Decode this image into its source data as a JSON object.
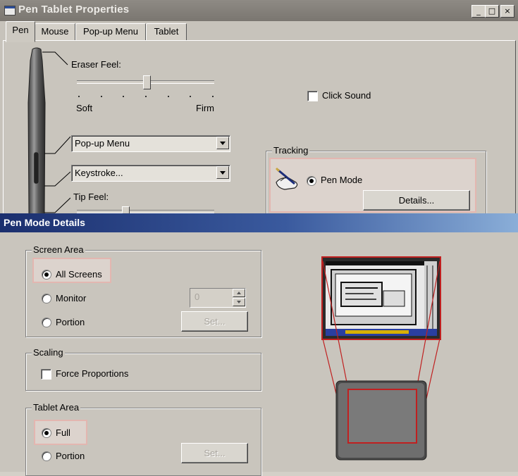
{
  "win1": {
    "title": "Pen Tablet Properties",
    "controls": {
      "minimize": "_",
      "maximize": "□",
      "close": "×"
    },
    "tabs": [
      {
        "label": "Pen",
        "active": true
      },
      {
        "label": "Mouse",
        "active": false
      },
      {
        "label": "Pop-up Menu",
        "active": false
      },
      {
        "label": "Tablet",
        "active": false
      }
    ],
    "eraser_feel": {
      "label": "Eraser Feel:",
      "min_label": "Soft",
      "max_label": "Firm",
      "ticks": 7,
      "value_fraction": 0.5
    },
    "side_switch_upper": "Pop-up Menu",
    "side_switch_lower": "Keystroke...",
    "tip_feel": {
      "label": "Tip Feel:"
    },
    "click_sound": {
      "label": "Click Sound",
      "checked": false
    },
    "tracking": {
      "title": "Tracking",
      "pen_mode_label": "Pen Mode",
      "details_button": "Details..."
    }
  },
  "win2": {
    "title": "Pen Mode Details",
    "screen_area": {
      "title": "Screen Area",
      "all_screens": "All Screens",
      "monitor": "Monitor",
      "portion": "Portion",
      "monitor_value": "0",
      "set_button": "Set..."
    },
    "scaling": {
      "title": "Scaling",
      "force_proportions": "Force Proportions"
    },
    "tablet_area": {
      "title": "Tablet Area",
      "full": "Full",
      "portion": "Portion",
      "set_button": "Set..."
    }
  },
  "colors": {
    "titlebar_active": "#1b2f6e",
    "highlight_border": "#e3b6b0",
    "mapping_lines": "#c02020"
  }
}
